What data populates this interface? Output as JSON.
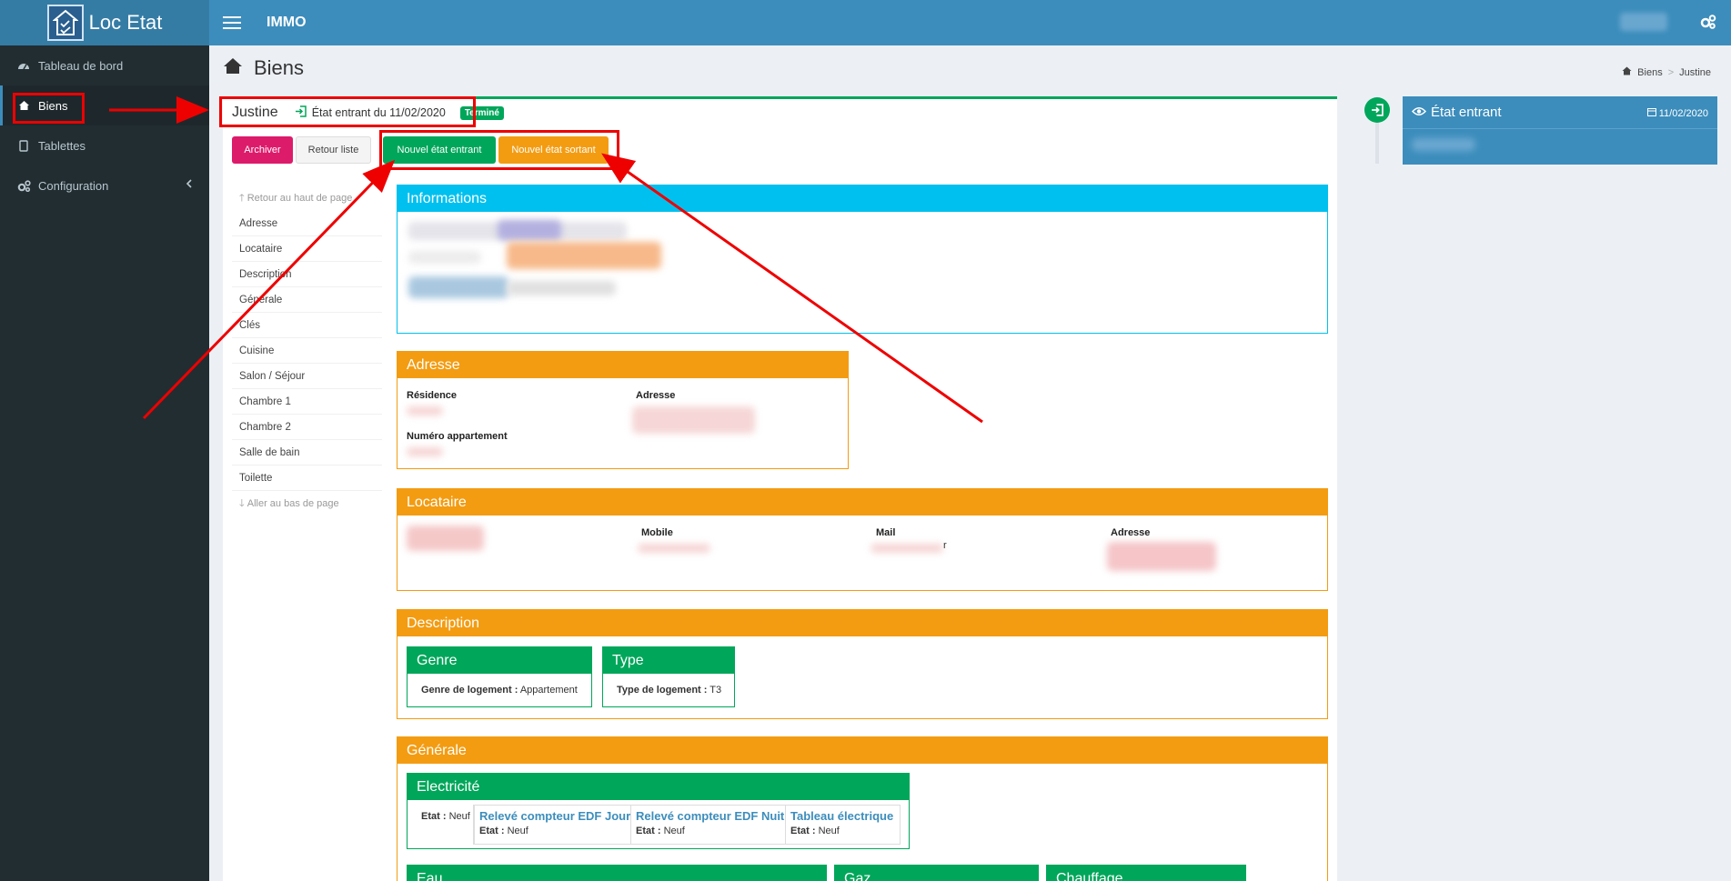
{
  "app": {
    "logo_text": "Loc Etat",
    "topbar_title": "IMMO"
  },
  "sidebar": {
    "items": [
      {
        "label": "Tableau de bord",
        "icon": "dashboard-icon"
      },
      {
        "label": "Biens",
        "icon": "home-icon",
        "active": true
      },
      {
        "label": "Tablettes",
        "icon": "tablet-icon"
      },
      {
        "label": "Configuration",
        "icon": "cogs-icon"
      }
    ]
  },
  "header": {
    "title": "Biens"
  },
  "breadcrumb": {
    "items": [
      "Biens",
      "Justine"
    ]
  },
  "panel": {
    "name": "Justine",
    "etat": "État entrant du 11/02/2020",
    "badge": "Terminé",
    "buttons": {
      "archiver": "Archiver",
      "retour": "Retour liste",
      "nouvel_entrant": "Nouvel état entrant",
      "nouvel_sortant": "Nouvel état sortant"
    }
  },
  "mini_nav": {
    "top": "Retour au haut de page",
    "items": [
      "Adresse",
      "Locataire",
      "Description",
      "Générale",
      "Clés",
      "Cuisine",
      "Salon / Séjour",
      "Chambre 1",
      "Chambre 2",
      "Salle de bain",
      "Toilette"
    ],
    "bottom": "Aller au bas de page"
  },
  "sections": {
    "informations": {
      "title": "Informations"
    },
    "adresse": {
      "title": "Adresse",
      "residence_label": "Résidence",
      "adresse_label": "Adresse",
      "numero_label": "Numéro appartement"
    },
    "locataire": {
      "title": "Locataire",
      "mobile_label": "Mobile",
      "mail_label": "Mail",
      "adresse_label": "Adresse",
      "mail_suffix": "r"
    },
    "description": {
      "title": "Description",
      "genre": {
        "title": "Genre",
        "label": "Genre de logement :",
        "value": "Appartement"
      },
      "type": {
        "title": "Type",
        "label": "Type de logement :",
        "value": "T3"
      }
    },
    "generale": {
      "title": "Générale",
      "electricite": {
        "title": "Electricité",
        "etat_label": "Etat :",
        "etat_value": "Neuf",
        "cells": [
          {
            "title": "Relevé compteur EDF Jour",
            "etat_label": "Etat :",
            "etat_value": "Neuf"
          },
          {
            "title": "Relevé compteur EDF Nuit",
            "etat_label": "Etat :",
            "etat_value": "Neuf"
          },
          {
            "title": "Tableau électrique",
            "etat_label": "Etat :",
            "etat_value": "Neuf"
          }
        ]
      },
      "eau": {
        "title": "Eau"
      },
      "gaz": {
        "title": "Gaz"
      },
      "chauffage": {
        "title": "Chauffage"
      }
    }
  },
  "timeline": {
    "title": "État entrant",
    "date": "11/02/2020"
  },
  "colors": {
    "green": "#00a65a",
    "orange": "#f39c12",
    "info": "#00c0ef",
    "pink": "#dd1b6b",
    "annotation": "#e00000"
  }
}
